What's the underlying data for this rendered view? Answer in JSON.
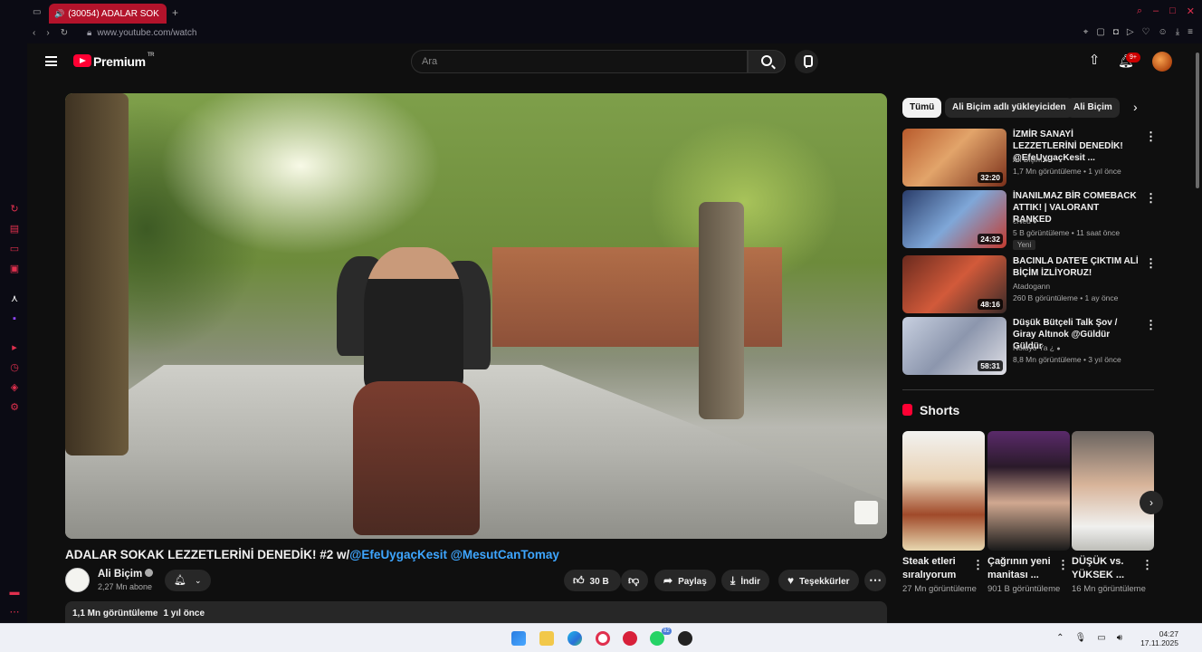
{
  "browser": {
    "tab_title": "(30054) ADALAR SOK",
    "url": "www.youtube.com/watch"
  },
  "header": {
    "logo_text": "Premium",
    "logo_sup": "TR",
    "search_placeholder": "Ara",
    "notification_count": "9+"
  },
  "video": {
    "title_text": "ADALAR SOKAK LEZZETLERİNİ DENEDİK! #2 w/",
    "title_link1": "@EfeUygaçKesit",
    "title_link2": "@MesutCanTomay",
    "channel_name": "Ali Biçim",
    "subscribers": "2,27 Mn abone",
    "like_count": "30 B",
    "share_label": "Paylaş",
    "download_label": "İndir",
    "thanks_label": "Teşekkürler",
    "views": "1,1 Mn görüntüleme",
    "published": "1 yıl önce"
  },
  "chips": [
    "Tümü",
    "Ali Biçim adlı yükleyiciden",
    "Ali Biçim"
  ],
  "related": [
    {
      "title": "İZMİR SANAYİ LEZZETLERİNİ DENEDİK! @EfeUygaçKesit ...",
      "channel": "Ali Biçim",
      "meta": "1,7 Mn görüntüleme • 1 yıl önce",
      "duration": "32:20",
      "badge": ""
    },
    {
      "title": "İNANILMAZ BİR COMEBACK ATTIK! | VALORANT RANKED",
      "channel": "cNed",
      "meta": "5 B görüntüleme • 11 saat önce",
      "duration": "24:32",
      "badge": "Yeni"
    },
    {
      "title": "BACINLA DATE'E ÇIKTIM ALİ BİÇİM İZLİYORUZ!",
      "channel": "Atadogann",
      "meta": "260 B görüntüleme • 1 ay önce",
      "duration": "48:16",
      "badge": ""
    },
    {
      "title": "Düşük Bütçeli Talk Şov / Giray Altınok @Güldür Güldür",
      "channel": "Noluyo Ya ¿",
      "meta": "8,8 Mn görüntüleme • 3 yıl önce",
      "duration": "58:31",
      "badge": ""
    }
  ],
  "shorts": {
    "heading": "Shorts",
    "items": [
      {
        "title": "Steak etleri sıralıyorum",
        "views": "27 Mn görüntüleme"
      },
      {
        "title": "Çağrının yeni manitası ...",
        "views": "901 B görüntüleme"
      },
      {
        "title": "DÜŞÜK vs. YÜKSEK ...",
        "views": "16 Mn görüntüleme"
      }
    ]
  },
  "taskbar": {
    "whatsapp_badge": "82",
    "time": "04:27",
    "date": "17.11.2025"
  }
}
